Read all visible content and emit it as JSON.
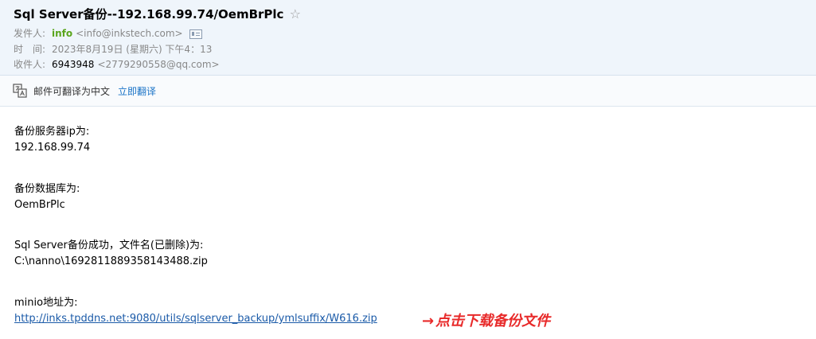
{
  "email": {
    "subject": "Sql Server备份--192.168.99.74/OemBrPlc",
    "star_icon": "☆",
    "sender_label": "发件人:",
    "sender_name": "info",
    "sender_address": "<info@inkstech.com>",
    "time_label": "时　间:",
    "time_value": "2023年8月19日 (星期六) 下午4：13",
    "recipient_label": "收件人:",
    "recipient_name": "6943948",
    "recipient_address": "<2779290558@qq.com>"
  },
  "translate": {
    "text": "邮件可翻译为中文",
    "link": "立即翻译",
    "icon": "translate-icon"
  },
  "body": {
    "line1": "备份服务器ip为:",
    "line2": "192.168.99.74",
    "line3": "备份数据库为:",
    "line4": "OemBrPlc",
    "line5": "Sql Server备份成功，文件名(已删除)为:",
    "line6": "C:\\nanno\\1692811889358143488.zip",
    "line7": "minio地址为:",
    "link": "http://inks.tpddns.net:9080/utils/sqlserver_backup/ymlsuffix/W616.zip"
  },
  "annotation": {
    "arrow": "→",
    "text": "点击下载备份文件",
    "color": "#e82a2a"
  }
}
